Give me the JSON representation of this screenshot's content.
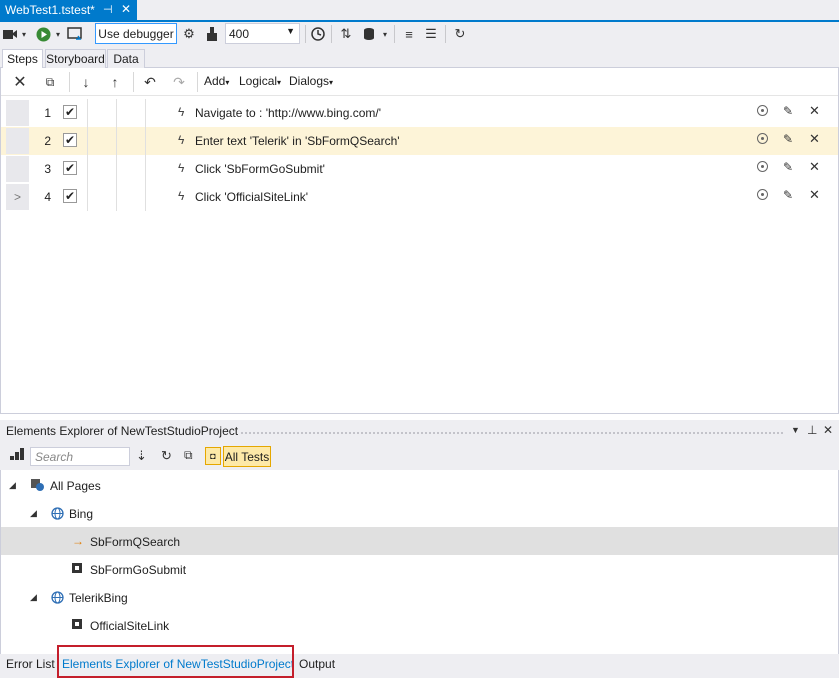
{
  "document_tab": {
    "title": "WebTest1.tstest*",
    "pin_icon": "pin-icon",
    "close_icon": "close-icon"
  },
  "toolbar": {
    "use_debugger_label": "Use debugger",
    "speed_value": "400"
  },
  "subtabs": [
    "Steps",
    "Storyboard",
    "Data"
  ],
  "steps_toolbar": {
    "menus": [
      "Add",
      "Logical",
      "Dialogs"
    ]
  },
  "steps": [
    {
      "num": "1",
      "checked": "✔",
      "text": "Navigate to : 'http://www.bing.com/'"
    },
    {
      "num": "2",
      "checked": "✔",
      "text": "Enter text 'Telerik' in 'SbFormQSearch'"
    },
    {
      "num": "3",
      "checked": "✔",
      "text": "Click 'SbFormGoSubmit'"
    },
    {
      "num": "4",
      "checked": "✔",
      "text": "Click 'OfficialSiteLink'"
    }
  ],
  "elements_explorer": {
    "title": "Elements Explorer of NewTestStudioProject",
    "search_placeholder": "Search",
    "all_tests_label": "All Tests",
    "tree": [
      {
        "label": "All Pages"
      },
      {
        "label": "Bing"
      },
      {
        "label": "SbFormQSearch"
      },
      {
        "label": "SbFormGoSubmit"
      },
      {
        "label": "TelerikBing"
      },
      {
        "label": "OfficialSiteLink"
      }
    ]
  },
  "bottom_tabs": [
    "Error List",
    "Elements Explorer of NewTestStudioProject",
    "Output"
  ],
  "colors": {
    "accent": "#007acc",
    "selected_row": "#fdf4d8",
    "highlight_box": "#c41e2b"
  }
}
